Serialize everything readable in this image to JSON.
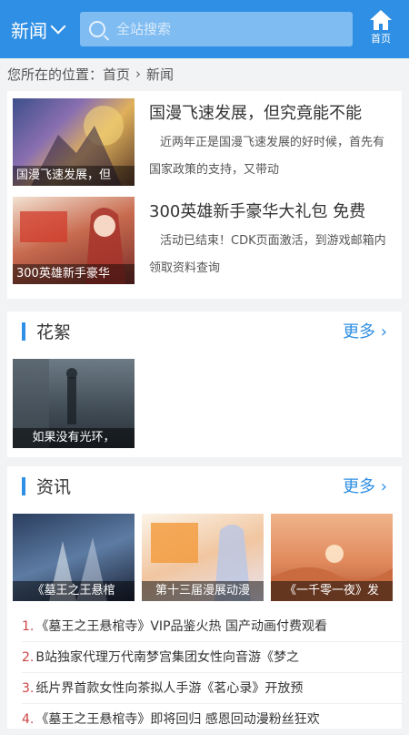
{
  "header": {
    "channel": "新闻",
    "search_placeholder": "全站搜索",
    "home_label": "首页"
  },
  "breadcrumb": {
    "prefix": "您所在的位置：",
    "home": "首页",
    "current": "新闻"
  },
  "news": [
    {
      "title": "国漫飞速发展，但究竟能不能",
      "desc": "近两年正是国漫飞速发展的好时候，首先有国家政策的支持，又带动",
      "caption": "国漫飞速发展，但"
    },
    {
      "title": "300英雄新手豪华大礼包 免费",
      "desc": "活动已结束！CDK页面激活，到游戏邮箱内领取资料查询",
      "caption": "300英雄新手豪华"
    }
  ],
  "sections": {
    "huaxu": {
      "title": "花絮",
      "more": "更多",
      "tile_caption": "如果没有光环，"
    },
    "zixun": {
      "title": "资讯",
      "more": "更多",
      "tiles": [
        "《墓王之王悬棺",
        "第十三届漫展动漫",
        "《一千零一夜》发"
      ],
      "list": [
        {
          "num": "1.",
          "text": "《墓王之王悬棺寺》VIP品鉴火热 国产动画付费观看"
        },
        {
          "num": "2.",
          "text": "B站独家代理万代南梦宫集团女性向音游《梦之"
        },
        {
          "num": "3.",
          "text": "纸片界首款女性向茶拟人手游《茗心录》开放预"
        },
        {
          "num": "4.",
          "text": "《墓王之王悬棺寺》即将回归 感恩回动漫粉丝狂欢"
        }
      ]
    }
  },
  "colors": {
    "accent": "#2f8fe4",
    "list_num": "#cc4444"
  }
}
